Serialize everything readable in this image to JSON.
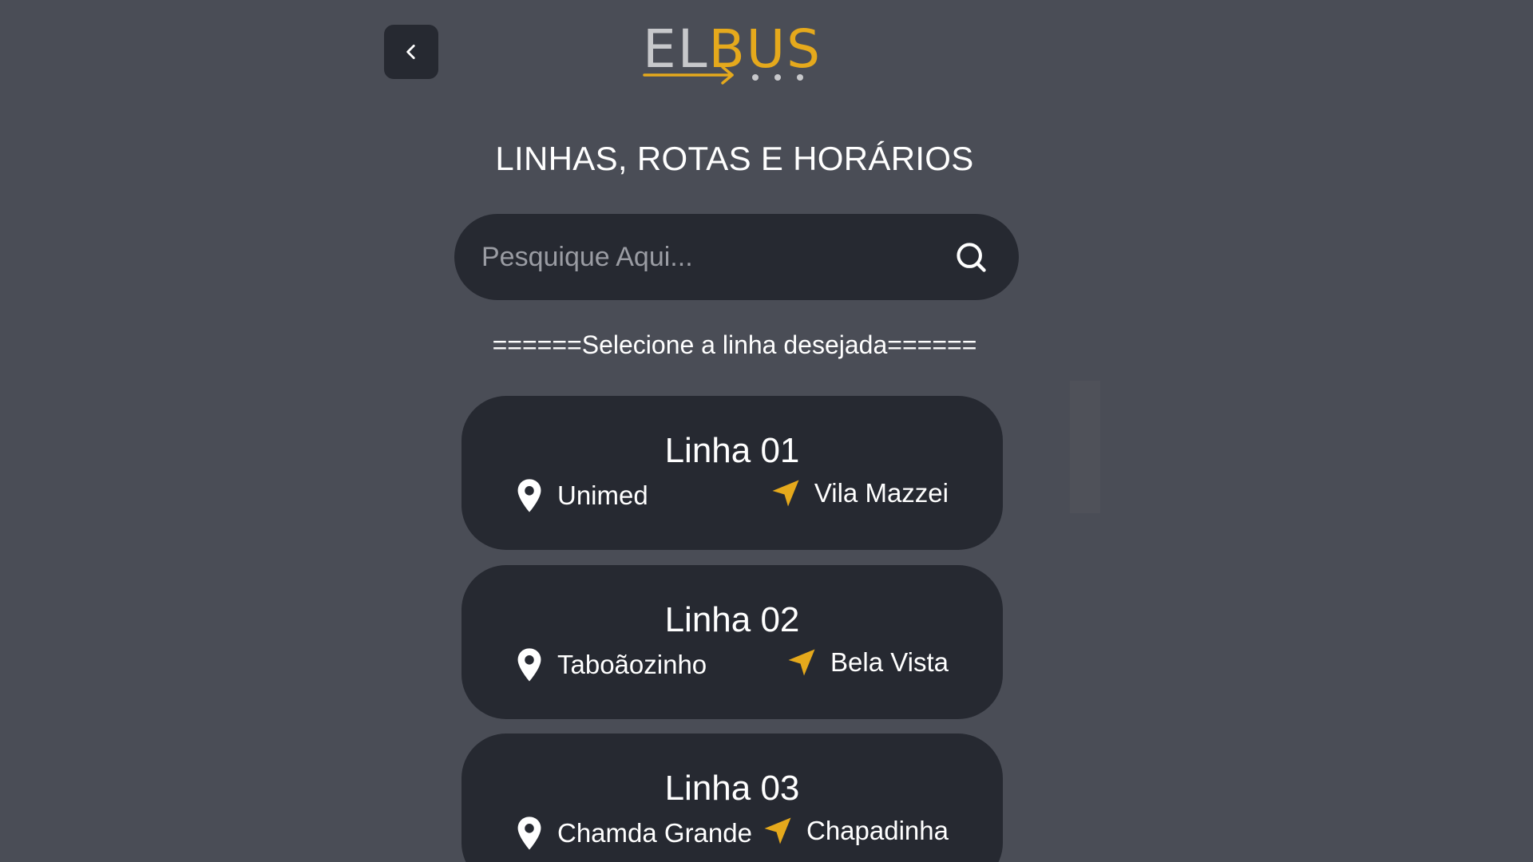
{
  "header": {
    "logo_text_el": "EL",
    "logo_text_bus": "BUS"
  },
  "page": {
    "title": "LINHAS, ROTAS E HORÁRIOS",
    "select_hint": "======Selecione a linha desejada======"
  },
  "search": {
    "placeholder": "Pesquique Aqui...",
    "value": ""
  },
  "lines": [
    {
      "title": "Linha 01",
      "origin": "Unimed",
      "destination": "Vila Mazzei"
    },
    {
      "title": "Linha 02",
      "origin": "Taboãozinho",
      "destination": "Bela Vista"
    },
    {
      "title": "Linha 03",
      "origin": "Chamda Grande",
      "destination": "Chapadinha"
    }
  ],
  "colors": {
    "background": "#4a4d56",
    "card": "#262931",
    "accent": "#e5a91c"
  },
  "icons": {
    "back": "chevron-left-icon",
    "search": "search-icon",
    "origin": "map-pin-icon",
    "destination": "navigation-arrow-icon"
  }
}
